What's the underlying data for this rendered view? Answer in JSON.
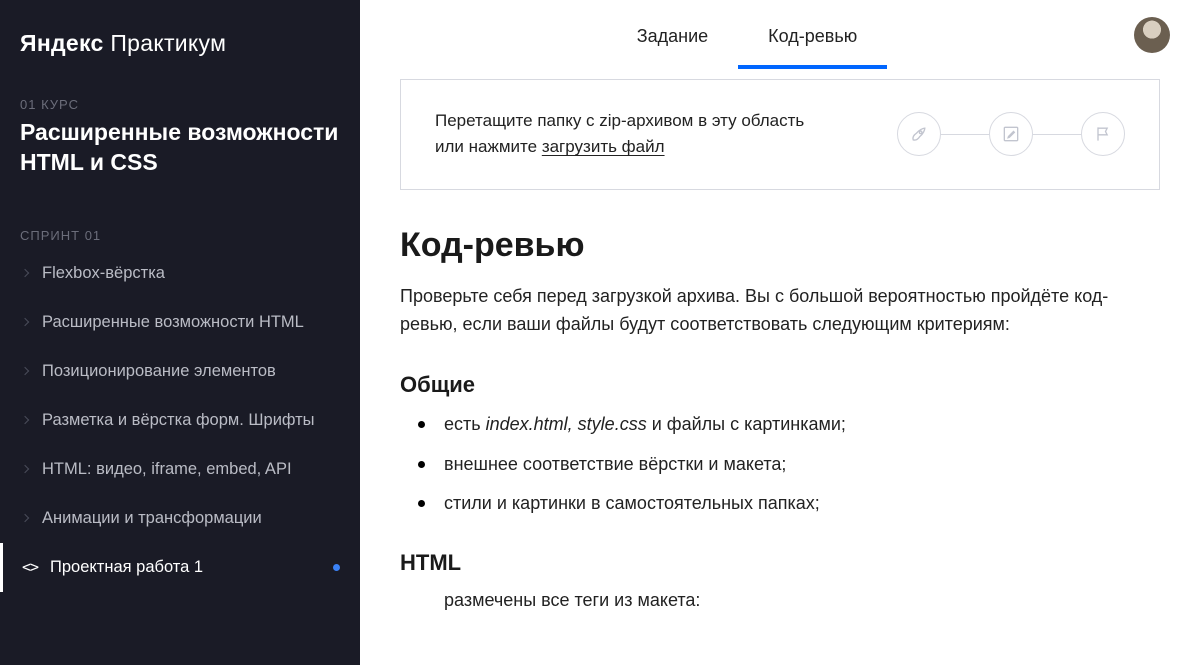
{
  "brand": {
    "bold": "Яндекс",
    "thin": " Практикум"
  },
  "sidebar": {
    "course_num": "01 КУРС",
    "course_title": "Расширенные возможности HTML и CSS",
    "sprint": "СПРИНТ 01",
    "items": [
      {
        "label": "Flexbox-вёрстка",
        "active": false
      },
      {
        "label": "Расширенные возможности HTML",
        "active": false
      },
      {
        "label": "Позиционирование элементов",
        "active": false
      },
      {
        "label": "Разметка и вёрстка форм. Шрифты",
        "active": false
      },
      {
        "label": "HTML: видео, iframe, embed, API",
        "active": false
      },
      {
        "label": "Анимации и трансформации",
        "active": false
      },
      {
        "label": "Проектная работа 1",
        "active": true,
        "icon": "code",
        "dot": true
      }
    ]
  },
  "tabs": [
    {
      "label": "Задание",
      "active": false
    },
    {
      "label": "Код-ревью",
      "active": true
    }
  ],
  "upload": {
    "line1": "Перетащите папку с zip-архивом в эту область",
    "line2_prefix": "или нажмите ",
    "link": "загрузить файл"
  },
  "article": {
    "h1": "Код-ревью",
    "lead": "Проверьте себя перед загрузкой архива. Вы с большой вероятностью пройдёте код-ревью, если ваши файлы будут соответствовать следующим критериям:",
    "sections": [
      {
        "title": "Общие",
        "items": [
          {
            "pre": "есть ",
            "em": "index.html, style.css",
            "post": " и файлы с картинками;"
          },
          {
            "pre": "внешнее соответствие вёрстки и макета;"
          },
          {
            "pre": "стили и картинки в самостоятельных папках;"
          }
        ]
      },
      {
        "title": "HTML",
        "trailing": "размечены все теги из макета:"
      }
    ]
  }
}
